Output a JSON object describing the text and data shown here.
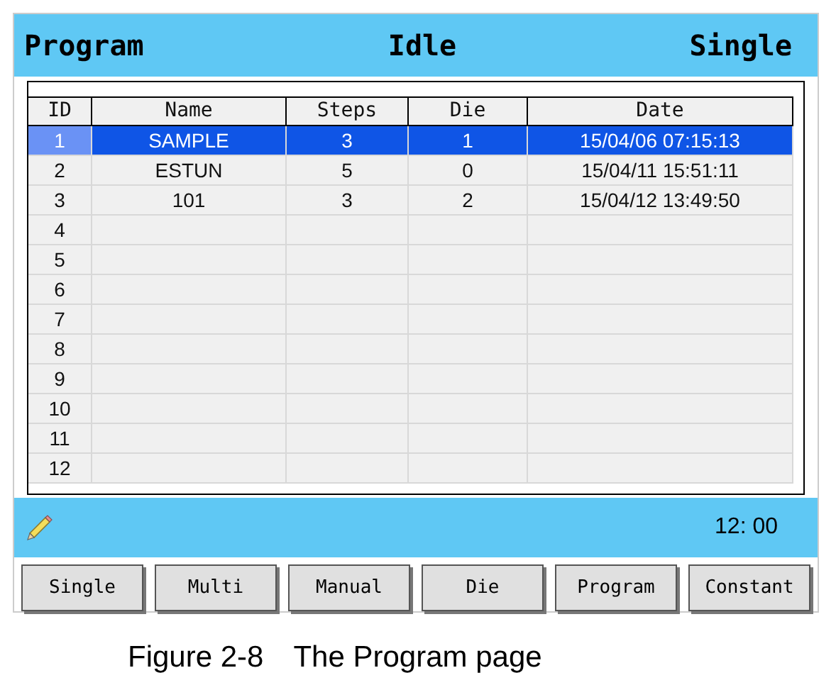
{
  "header": {
    "title": "Program",
    "status": "Idle",
    "mode": "Single"
  },
  "table": {
    "columns": [
      "ID",
      "Name",
      "Steps",
      "Die",
      "Date"
    ],
    "rows": [
      {
        "cells": [
          "1",
          "SAMPLE",
          "3",
          "1",
          "15/04/06 07:15:13"
        ],
        "selected": true
      },
      {
        "cells": [
          "2",
          "ESTUN",
          "5",
          "0",
          "15/04/11 15:51:11"
        ],
        "selected": false
      },
      {
        "cells": [
          "3",
          "101",
          "3",
          "2",
          "15/04/12 13:49:50"
        ],
        "selected": false
      },
      {
        "cells": [
          "4"
        ],
        "selected": false
      },
      {
        "cells": [
          "5"
        ],
        "selected": false
      },
      {
        "cells": [
          "6"
        ],
        "selected": false
      },
      {
        "cells": [
          "7"
        ],
        "selected": false
      },
      {
        "cells": [
          "8"
        ],
        "selected": false
      },
      {
        "cells": [
          "9"
        ],
        "selected": false
      },
      {
        "cells": [
          "10"
        ],
        "selected": false
      },
      {
        "cells": [
          "11"
        ],
        "selected": false
      },
      {
        "cells": [
          "12"
        ],
        "selected": false
      }
    ]
  },
  "status_bar": {
    "time": "12: 00"
  },
  "buttons": [
    "Single",
    "Multi",
    "Manual",
    "Die",
    "Program",
    "Constant"
  ],
  "caption": "Figure 2-8　The Program page"
}
